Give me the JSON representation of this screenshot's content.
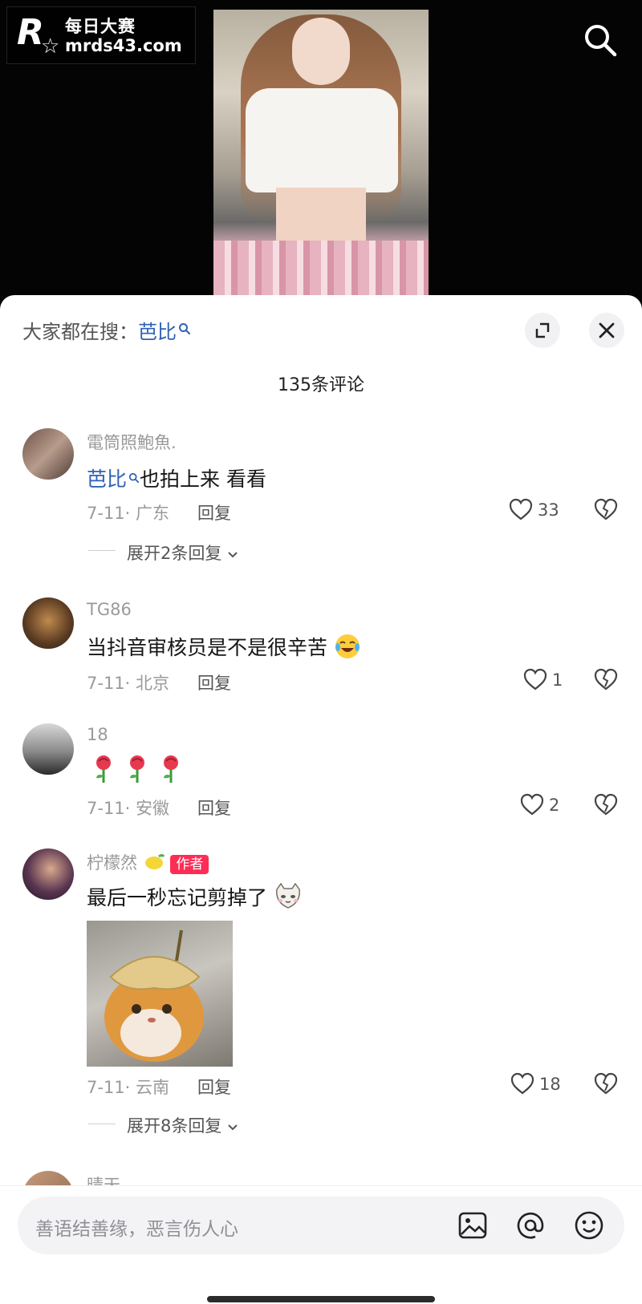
{
  "watermark": {
    "cn": "每日大赛",
    "url": "mrds43.com"
  },
  "sheet": {
    "hot_search_prefix": "大家都在搜：",
    "hot_search_keyword": "芭比",
    "comment_count_title": "135条评论"
  },
  "comments": [
    {
      "user": "電筒照鮑魚.",
      "text_keyword": "芭比",
      "text": "也拍上来 看看",
      "meta": "7-11· 广东",
      "reply": "回复",
      "likes": "33",
      "expand": "展开2条回复"
    },
    {
      "user": "TG86",
      "text": "当抖音审核员是不是很辛苦",
      "emoji": "laugh-cry-emoji",
      "meta": "7-11· 北京",
      "reply": "回复",
      "likes": "1"
    },
    {
      "user": "18",
      "text": "",
      "emoji": "rose-emoji",
      "meta": "7-11· 安徽",
      "reply": "回复",
      "likes": "2"
    },
    {
      "user": "柠檬然",
      "badge": "作者",
      "text": "最后一秒忘记剪掉了",
      "emoji": "cat-face-emoji",
      "meta": "7-11· 云南",
      "reply": "回复",
      "likes": "18",
      "expand": "展开8条回复"
    },
    {
      "user": "晴天"
    }
  ],
  "input": {
    "placeholder": "善语结善缘，恶言伤人心"
  },
  "colors": {
    "accent_blue": "#2f62b3",
    "author_badge": "#fd2d55"
  }
}
